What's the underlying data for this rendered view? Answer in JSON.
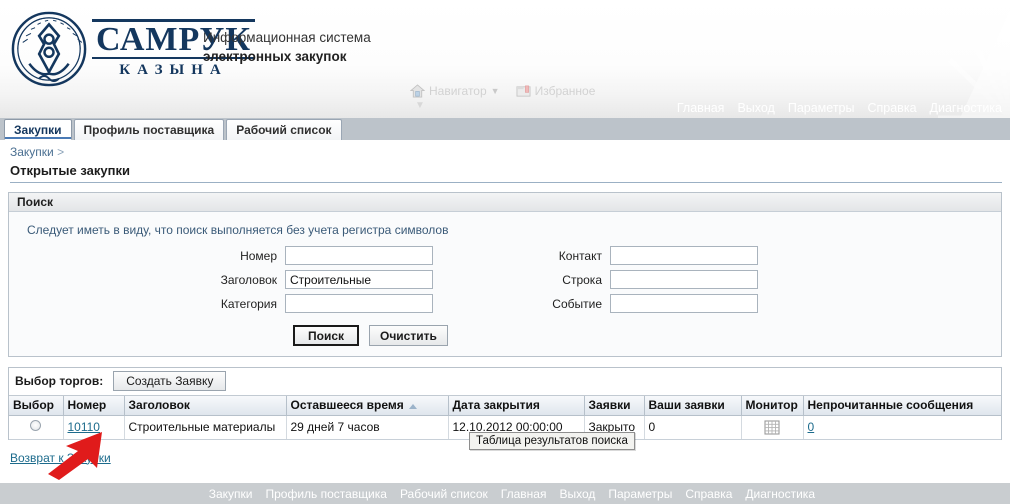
{
  "header": {
    "logo_primary": "САМРУК",
    "logo_secondary": "КАЗЫНА",
    "system_title_line1": "Информационная система",
    "system_title_line2": "электронных закупок",
    "ghost_text": "",
    "navigator_label": "Навигатор",
    "favorites_label": "Избранное",
    "topnav": [
      "Главная",
      "Выход",
      "Параметры",
      "Справка",
      "Диагностика"
    ]
  },
  "tabs": [
    {
      "label": "Закупки",
      "active": true
    },
    {
      "label": "Профиль поставщика",
      "active": false
    },
    {
      "label": "Рабочий список",
      "active": false
    }
  ],
  "breadcrumb": {
    "item": "Закупки",
    "separator": ">"
  },
  "page_title": "Открытые закупки",
  "search_panel": {
    "title": "Поиск",
    "hint": "Следует иметь в виду, что поиск выполняется без учета регистра символов",
    "left_fields": [
      {
        "label": "Номер",
        "value": ""
      },
      {
        "label": "Заголовок",
        "value": "Строительные"
      },
      {
        "label": "Категория",
        "value": ""
      }
    ],
    "right_fields": [
      {
        "label": "Контакт",
        "value": ""
      },
      {
        "label": "Строка",
        "value": ""
      },
      {
        "label": "Событие",
        "value": ""
      }
    ],
    "search_button": "Поиск",
    "clear_button": "Очистить"
  },
  "results": {
    "toolbar_label": "Выбор торгов:",
    "create_button": "Создать Заявку",
    "columns": [
      "Выбор",
      "Номер",
      "Заголовок",
      "Оставшееся время",
      "Дата закрытия",
      "Заявки",
      "Ваши заявки",
      "Монитор",
      "Непрочитанные сообщения"
    ],
    "sorted_column": "Оставшееся время",
    "sort_direction": "ascending",
    "rows": [
      {
        "number": "10110",
        "title": "Строительные материалы",
        "remaining": "29 дней 7 часов",
        "close_date": "12.10.2012 00:00:00",
        "bids": "Закрыто",
        "your_bids": "0",
        "monitor_icon": "grid-icon",
        "unread": "0"
      }
    ],
    "tooltip": "Таблица результатов поиска"
  },
  "back_link": "Возврат к Закупки",
  "footer": {
    "links": [
      "Закупки",
      "Профиль поставщика",
      "Рабочий список",
      "Главная",
      "Выход",
      "Параметры",
      "Справка",
      "Диагностика"
    ]
  },
  "colors": {
    "brand_navy": "#14375e",
    "tab_strip": "#bcc3ca",
    "link": "#1c6b8c",
    "annotation_arrow": "#e01b1b",
    "footer_bg": "#c9cdd0"
  }
}
